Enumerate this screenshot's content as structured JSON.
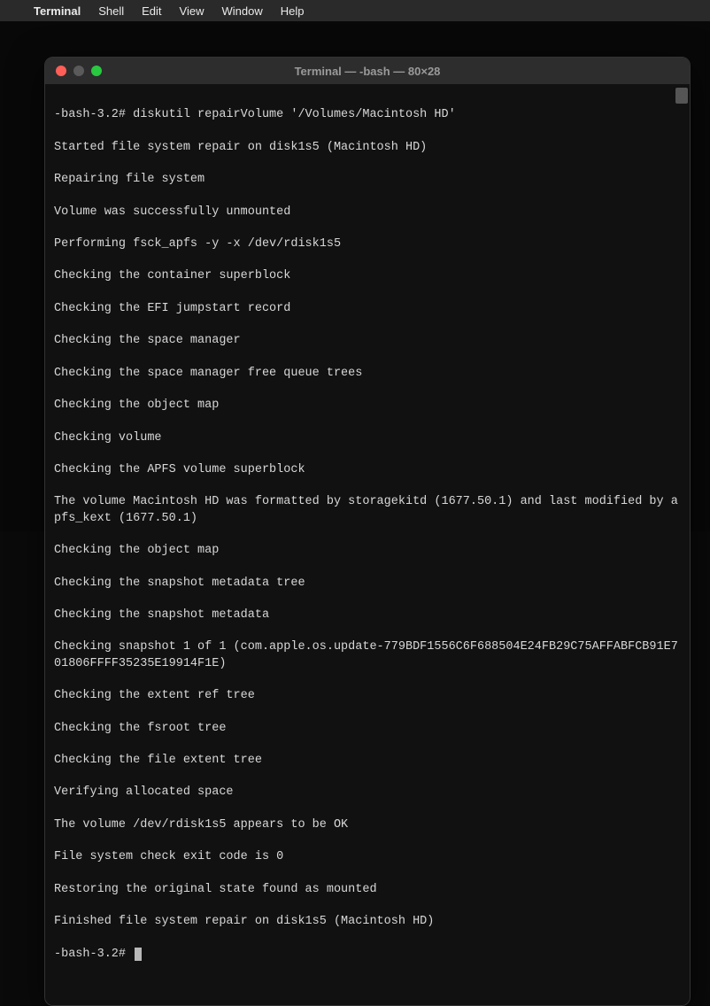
{
  "menubar": {
    "app_name": "Terminal",
    "items": [
      "Shell",
      "Edit",
      "View",
      "Window",
      "Help"
    ]
  },
  "window": {
    "title": "Terminal — -bash — 80×28"
  },
  "terminal": {
    "prompt1": "-bash-3.2# diskutil repairVolume '/Volumes/Macintosh HD'",
    "lines": [
      "Started file system repair on disk1s5 (Macintosh HD)",
      "Repairing file system",
      "Volume was successfully unmounted",
      "Performing fsck_apfs -y -x /dev/rdisk1s5",
      "Checking the container superblock",
      "Checking the EFI jumpstart record",
      "Checking the space manager",
      "Checking the space manager free queue trees",
      "Checking the object map",
      "Checking volume",
      "Checking the APFS volume superblock",
      "The volume Macintosh HD was formatted by storagekitd (1677.50.1) and last modified by apfs_kext (1677.50.1)",
      "Checking the object map",
      "Checking the snapshot metadata tree",
      "Checking the snapshot metadata",
      "Checking snapshot 1 of 1 (com.apple.os.update-779BDF1556C6F688504E24FB29C75AFFABFCB91E701806FFFF35235E19914F1E)",
      "Checking the extent ref tree",
      "Checking the fsroot tree",
      "Checking the file extent tree",
      "Verifying allocated space",
      "The volume /dev/rdisk1s5 appears to be OK",
      "File system check exit code is 0",
      "Restoring the original state found as mounted",
      "Finished file system repair on disk1s5 (Macintosh HD)"
    ],
    "prompt2": "-bash-3.2# "
  }
}
